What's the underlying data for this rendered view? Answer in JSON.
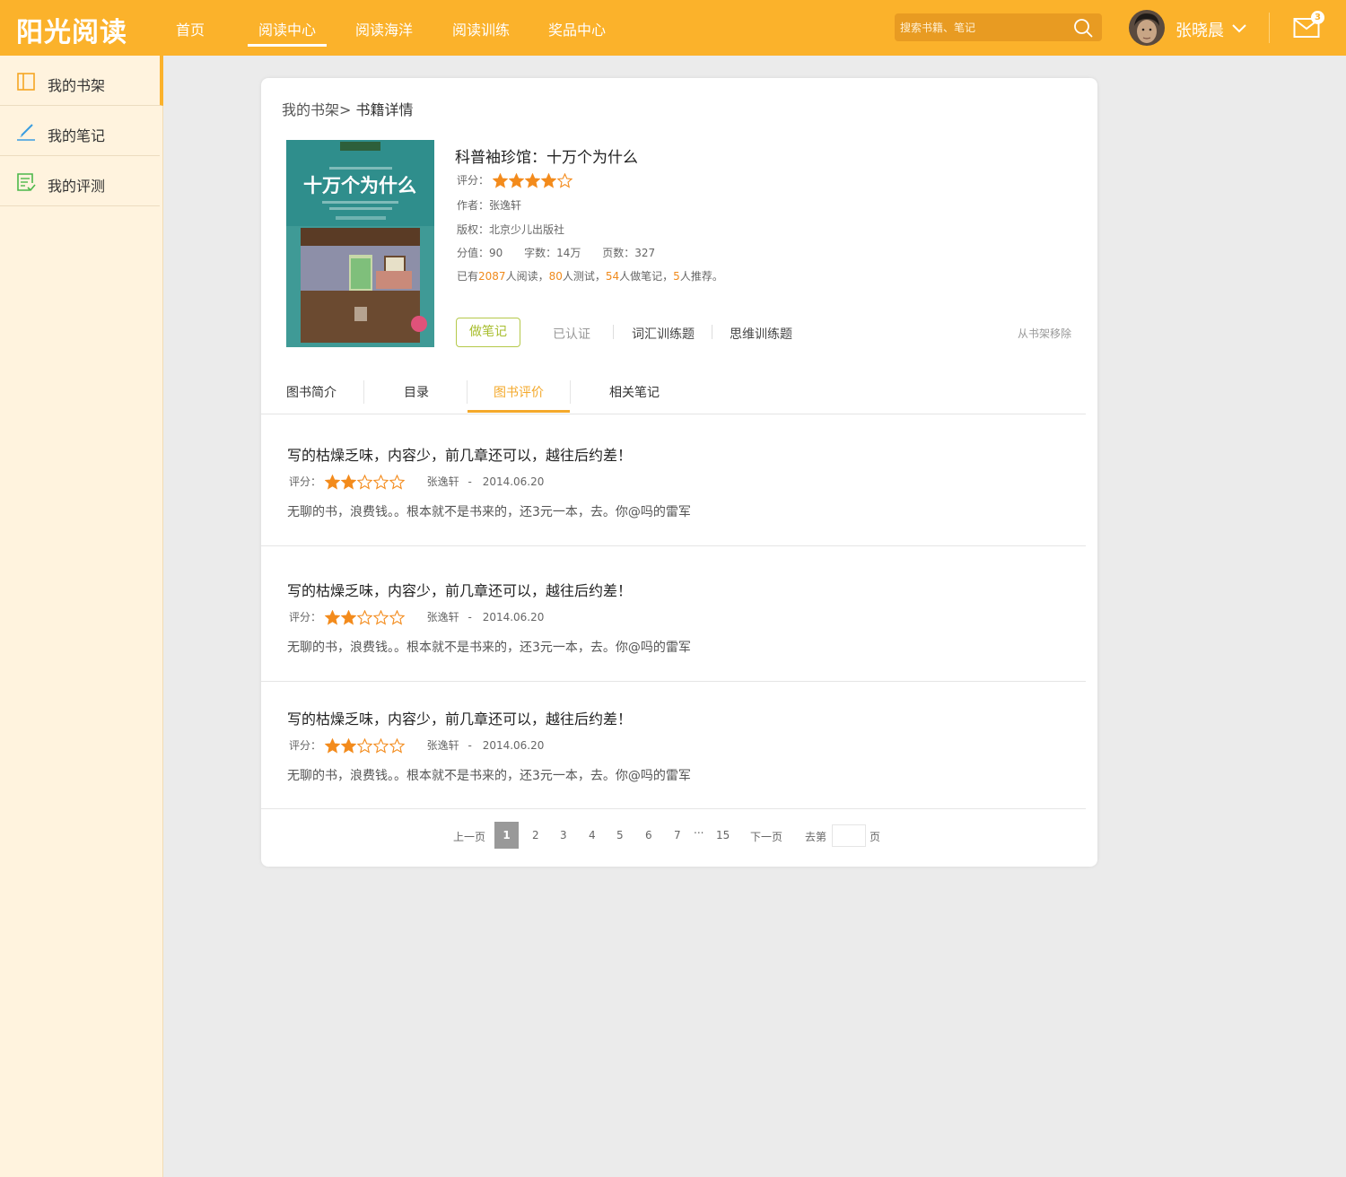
{
  "header": {
    "logo": "阳光阅读",
    "nav": [
      {
        "label": "首页",
        "active": false
      },
      {
        "label": "阅读中心",
        "active": true
      },
      {
        "label": "阅读海洋",
        "active": false
      },
      {
        "label": "阅读训练",
        "active": false
      },
      {
        "label": "奖品中心",
        "active": false
      }
    ],
    "search_placeholder": "搜索书籍、笔记",
    "username": "张晓晨",
    "mail_count": "3",
    "accent_color": "#fbb22b"
  },
  "sidebar": {
    "items": [
      {
        "label": "我的书架",
        "icon": "bookshelf-icon",
        "active": true
      },
      {
        "label": "我的笔记",
        "icon": "pen-icon",
        "active": false
      },
      {
        "label": "我的评测",
        "icon": "checklist-icon",
        "active": false
      }
    ]
  },
  "breadcrumb": {
    "parent": "我的书架>",
    "current": "书籍详情"
  },
  "book": {
    "title": "科普袖珍馆：十万个为什么",
    "cover_title": "十万个为什么",
    "rating_label": "评分：",
    "rating": 4,
    "author": "作者：张逸轩",
    "publisher": "版权：北京少儿出版社",
    "score": "分值：90",
    "words": "字数：14万",
    "pages": "页数：327",
    "stats": {
      "prefix": "已有",
      "readers": "2087",
      "readers_label": "人阅读，",
      "testers": "80",
      "testers_label": "人测试，",
      "notes": "54",
      "notes_label": "人做笔记，",
      "recommends": "5",
      "recommends_label": "人推荐。"
    },
    "actions": {
      "note": "做笔记",
      "verified": "已认证",
      "vocab": "词汇训练题",
      "thinking": "思维训练题",
      "remove": "从书架移除"
    }
  },
  "tabs": [
    {
      "label": "图书简介",
      "active": false
    },
    {
      "label": "目录",
      "active": false
    },
    {
      "label": "图书评价",
      "active": true
    },
    {
      "label": "相关笔记",
      "active": false
    }
  ],
  "reviews": [
    {
      "title": "写的枯燥乏味，内容少，前几章还可以，越往后约差！",
      "rating_label": "评分：",
      "rating": 2,
      "author": "张逸轩",
      "sep": "-",
      "date": "2014.06.20",
      "body": "无聊的书，浪费钱。。根本就不是书来的，还3元一本，去。你@吗的雷军"
    },
    {
      "title": "写的枯燥乏味，内容少，前几章还可以，越往后约差！",
      "rating_label": "评分：",
      "rating": 2,
      "author": "张逸轩",
      "sep": "-",
      "date": "2014.06.20",
      "body": "无聊的书，浪费钱。。根本就不是书来的，还3元一本，去。你@吗的雷军"
    },
    {
      "title": "写的枯燥乏味，内容少，前几章还可以，越往后约差！",
      "rating_label": "评分：",
      "rating": 2,
      "author": "张逸轩",
      "sep": "-",
      "date": "2014.06.20",
      "body": "无聊的书，浪费钱。。根本就不是书来的，还3元一本，去。你@吗的雷军"
    }
  ],
  "pager": {
    "prev": "上一页",
    "pages": [
      "1",
      "2",
      "3",
      "4",
      "5",
      "6",
      "7"
    ],
    "ellipsis": "...",
    "last": "15",
    "next": "下一页",
    "goto_prefix": "去第",
    "goto_suffix": "页",
    "current": "1"
  }
}
